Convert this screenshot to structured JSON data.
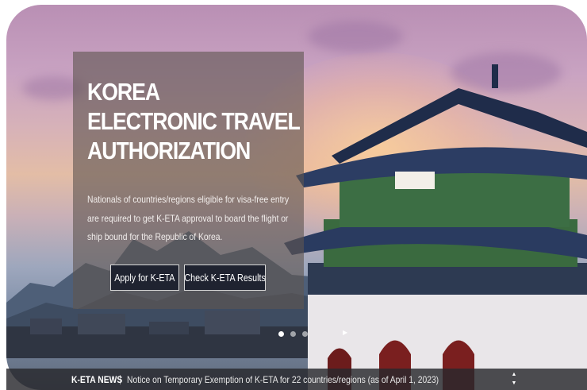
{
  "hero": {
    "title_lines": [
      "KOREA",
      "ELECTRONIC TRAVEL",
      "AUTHORIZATION"
    ],
    "description": "Nationals of countries/regions eligible for visa-free entry are required to get K-ETA approval to board the flight or ship bound for the Republic of Korea.",
    "buttons": {
      "apply": "Apply for K-ETA",
      "check": "Check K-ETA Results"
    }
  },
  "carousel": {
    "total_slides": 3,
    "active_index": 0
  },
  "news": {
    "label": "K-ETA NEWS",
    "headline": "Notice on Temporary Exemption of K-ETA for 22 countries/regions (as of April 1, 2023)"
  },
  "icons": [
    "slider-pause-icon",
    "news-up-arrow-icon",
    "news-down-arrow-icon"
  ],
  "colors": {
    "panel": "#5f5550",
    "button": "#1f2330",
    "news_bar": "#28282d"
  }
}
